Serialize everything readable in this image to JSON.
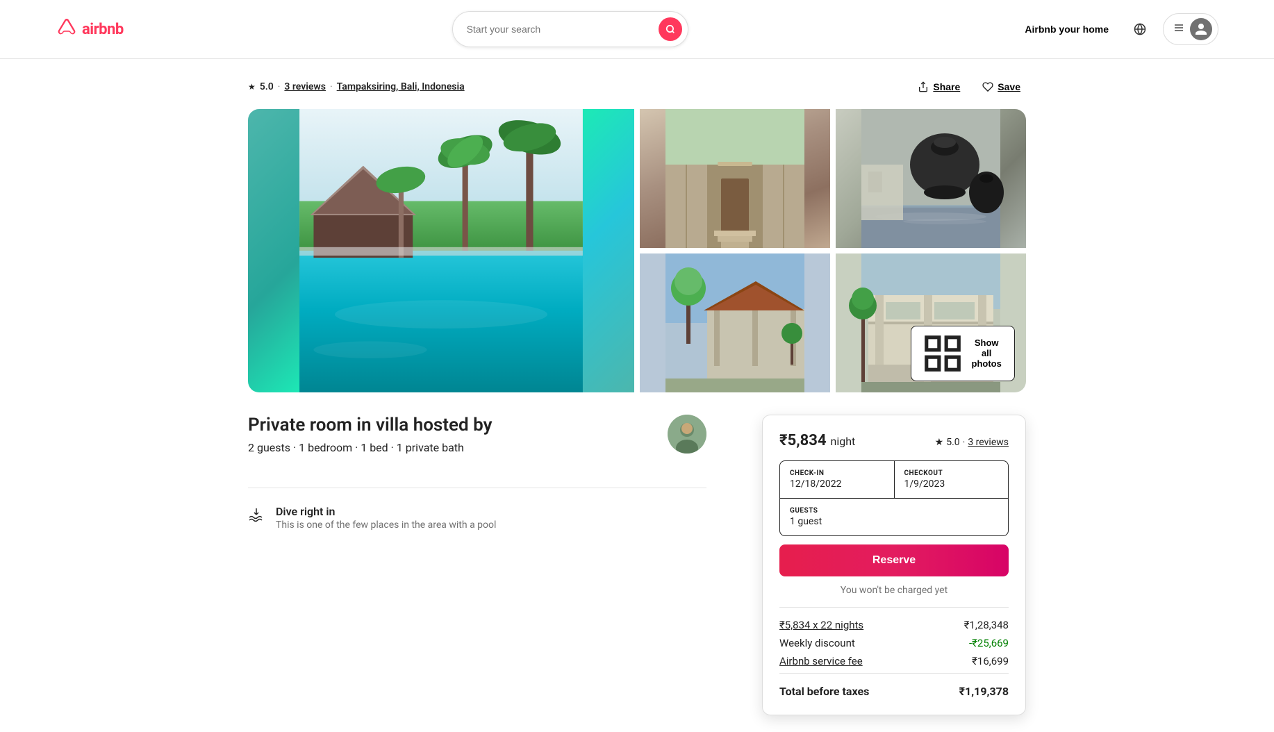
{
  "header": {
    "logo_text": "airbnb",
    "search_placeholder": "Start your search",
    "host_link": "Airbnb your home",
    "user_menu_label": "Menu"
  },
  "listing": {
    "rating": "5.0",
    "reviews_count": "3 reviews",
    "location": "Tampaksiring, Bali, Indonesia",
    "share_label": "Share",
    "save_label": "Save",
    "title": "Private room in villa hosted by",
    "subtitle": "2 guests · 1 bedroom · 1 bed · 1 private bath",
    "show_all_photos": "Show all photos",
    "grid_icon": "⊞",
    "feature": {
      "title": "Dive right in",
      "desc": "This is one of the few places in the area with a pool"
    }
  },
  "booking_card": {
    "price_amount": "",
    "price_night": "night",
    "rating": "5.0",
    "reviews_link": "3 reviews",
    "checkin_label": "CHECK-IN",
    "checkin_value": "12/18/2022",
    "checkout_label": "CHECKOUT",
    "checkout_value": "1/9/2023",
    "guests_label": "GUESTS",
    "guests_value": "1 guest",
    "reserve_label": "Reserve",
    "no_charge_text": "You won't be charged yet",
    "price_lines": [
      {
        "label": "₹5,834 x 22 nights",
        "value": "₹1,28,348",
        "underline": true
      },
      {
        "label": "Weekly discount",
        "value": "-₹25,669",
        "underline": false
      },
      {
        "label": "Airbnb service fee",
        "value": "₹16,699",
        "underline": false
      }
    ],
    "total_label": "Total before taxes",
    "total_value": "₹1,19,378"
  },
  "icons": {
    "star": "★",
    "share": "↗",
    "heart": "♡",
    "search": "🔍",
    "globe": "🌐",
    "hamburger": "☰",
    "user": "👤",
    "pool": "🏊",
    "grid": "⊞"
  }
}
